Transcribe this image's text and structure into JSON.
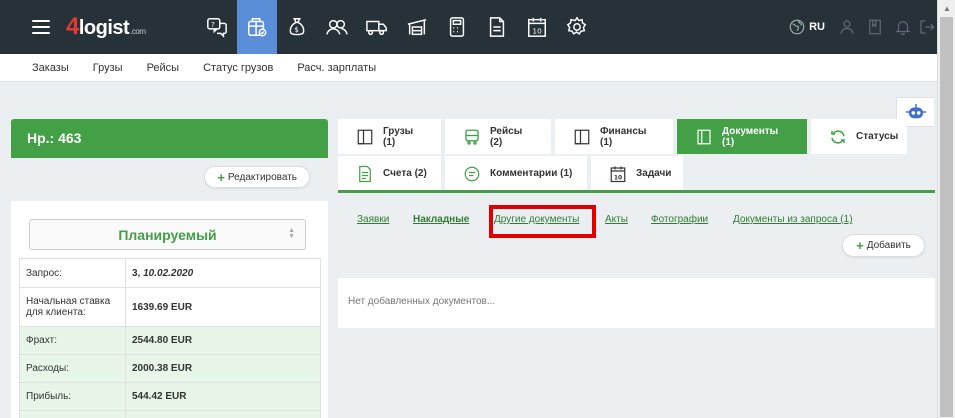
{
  "logo": {
    "four": "4",
    "rest": "logist",
    "com": ".com"
  },
  "topbar": {
    "lang": "RU"
  },
  "subnav": [
    "Заказы",
    "Грузы",
    "Рейсы",
    "Статус грузов",
    "Расч. зарплаты"
  ],
  "order": {
    "title": "Нр.: 463",
    "edit_label": "Редактировать",
    "status": "Планируемый",
    "rows": [
      {
        "key": "Запрос:",
        "value": "3, 10.02.2020"
      },
      {
        "key": "Начальная ставка для клиента:",
        "value": "1639.69 EUR"
      },
      {
        "key": "Фрахт:",
        "value": "2544.80 EUR"
      },
      {
        "key": "Расходы:",
        "value": "2000.38 EUR"
      },
      {
        "key": "Прибыль:",
        "value": "544.42 EUR"
      }
    ]
  },
  "tabs": {
    "row1": [
      {
        "label": "Грузы (1)",
        "icon": "cargo-icon"
      },
      {
        "label": "Рейсы (2)",
        "icon": "bus-icon"
      },
      {
        "label": "Финансы (1)",
        "icon": "finance-icon"
      },
      {
        "label": "Документы (1)",
        "icon": "documents-icon",
        "active": true
      },
      {
        "label": "Статусы",
        "icon": "refresh-icon"
      }
    ],
    "row2": [
      {
        "label": "Счета (2)",
        "icon": "invoice-icon"
      },
      {
        "label": "Комментарии (1)",
        "icon": "comment-icon"
      },
      {
        "label": "Задачи",
        "icon": "calendar-icon"
      }
    ]
  },
  "doc_links": [
    {
      "label": "Заявки"
    },
    {
      "label": "Накладные"
    },
    {
      "label": "Другие документы"
    },
    {
      "label": "Акты"
    },
    {
      "label": "Фотографии"
    },
    {
      "label": "Документы из запроса (1)"
    }
  ],
  "add_label": "Добавить",
  "empty_text": "Нет добавленных документов...",
  "colors": {
    "green": "#43a047",
    "topbar": "#263238",
    "active_nav": "#5b8ed9",
    "highlight": "#e00000"
  }
}
